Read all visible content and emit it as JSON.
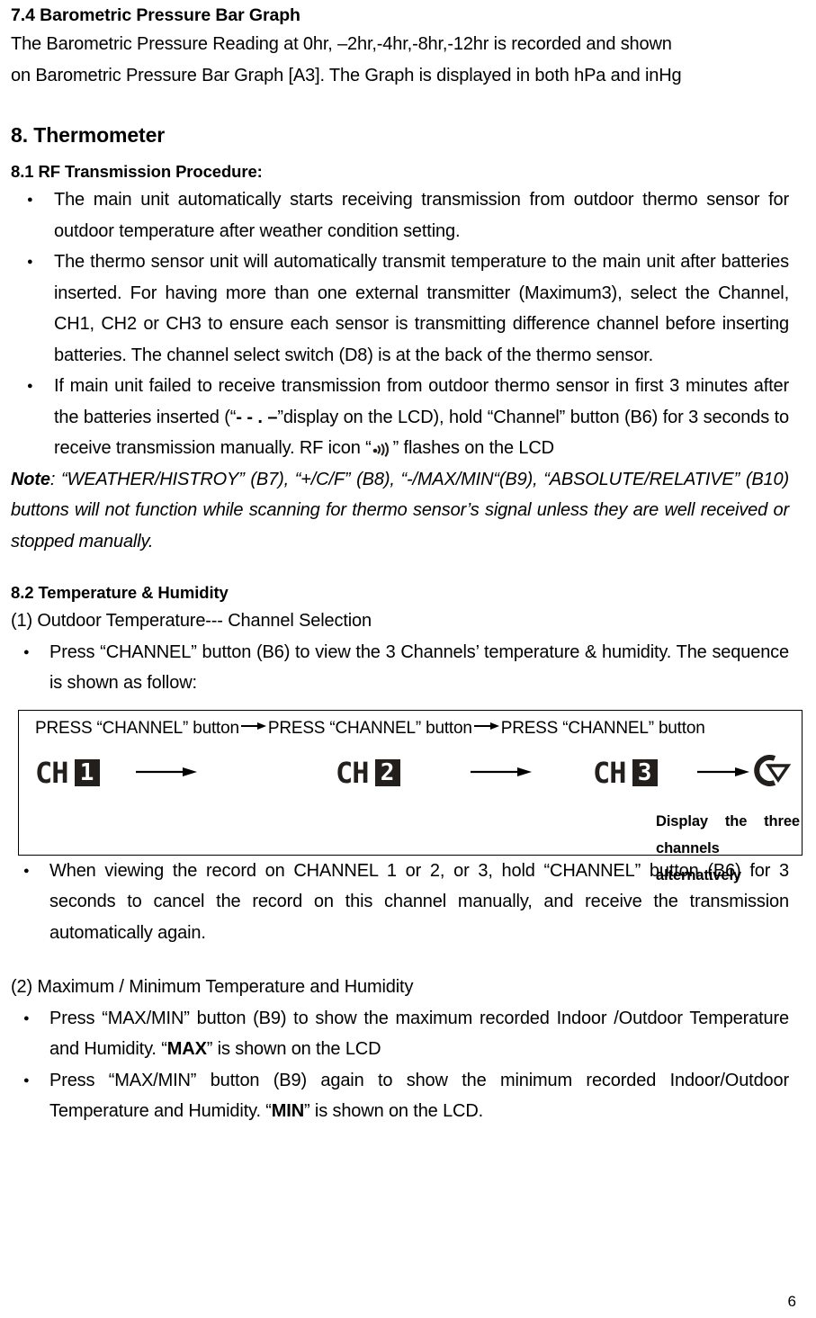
{
  "document": {
    "page_number": "6"
  },
  "section_7_4": {
    "heading": "7.4 Barometric Pressure Bar Graph",
    "paragraph_line1": "The Barometric Pressure Reading at 0hr, –2hr,-4hr,-8hr,-12hr is recorded and shown",
    "paragraph_line2": "on Barometric Pressure Bar Graph [A3]. The Graph is displayed in both hPa and inHg"
  },
  "section_8": {
    "heading": "8. Thermometer"
  },
  "section_8_1": {
    "heading": "8.1 RF Transmission Procedure:",
    "bullets": [
      "The main unit automatically starts receiving transmission from outdoor thermo sensor for outdoor temperature after weather condition setting.",
      "The thermo sensor unit will automatically transmit temperature to the main unit after batteries inserted. For having more than one external transmitter (Maximum3), select the Channel, CH1, CH2 or CH3 to ensure each sensor is transmitting difference channel before inserting batteries. The channel select switch (D8) is at the back of the thermo sensor."
    ],
    "bullet3": {
      "part1": "If main unit failed to receive transmission from outdoor thermo sensor in first 3 minutes after the batteries inserted (“",
      "lcd_dashes": "- - . –",
      "part2": "”display on the LCD), hold “Channel” button (B6) for 3 seconds to receive transmission manually. RF icon “",
      "rf_icon_name": "rf-signal-icon",
      "part3": "” flashes on the LCD"
    },
    "note": {
      "label": "Note",
      "colon": ":",
      "text": " “WEATHER/HISTROY” (B7), “+/C/F” (B8), “-/MAX/MIN“(B9), “ABSOLUTE/RELATIVE” (B10) buttons will not function while scanning for thermo sensor’s signal unless they are well received or stopped manually."
    }
  },
  "section_8_2": {
    "heading": "8.2 Temperature & Humidity",
    "item1_heading": "(1) Outdoor Temperature--- Channel Selection",
    "item1_bullet": "Press “CHANNEL” button (B6) to view the 3 Channels’ temperature & humidity. The sequence is shown as follow:",
    "diagram": {
      "header_steps": [
        "PRESS “CHANNEL” button",
        "PRESS “CHANNEL” button",
        "PRESS “CHANNEL” button"
      ],
      "channels": [
        {
          "label": "CH",
          "digit": "1"
        },
        {
          "label": "CH",
          "digit": "2"
        },
        {
          "label": "CH",
          "digit": "3"
        }
      ],
      "loop_icon_name": "cycle-loop-icon",
      "caption_line1": "Display the three",
      "caption_line2": "channels alternatively"
    },
    "item1_bullet2": "When viewing the record on CHANNEL 1 or 2, or 3, hold “CHANNEL” button (B6) for 3 seconds to cancel the record on this channel manually, and receive the transmission automatically again.",
    "item2_heading": " (2) Maximum / Minimum Temperature and Humidity",
    "item2_bullet1": {
      "part1": "Press “MAX/MIN” button (B9) to show the maximum recorded Indoor /Outdoor Temperature and Humidity. “",
      "emphasis": "MAX",
      "part2": "” is shown on the LCD"
    },
    "item2_bullet2": {
      "part1": "Press “MAX/MIN” button (B9) again to show the minimum recorded Indoor/Outdoor Temperature and Humidity. “",
      "emphasis": "MIN",
      "part2": "” is shown on the LCD."
    }
  }
}
